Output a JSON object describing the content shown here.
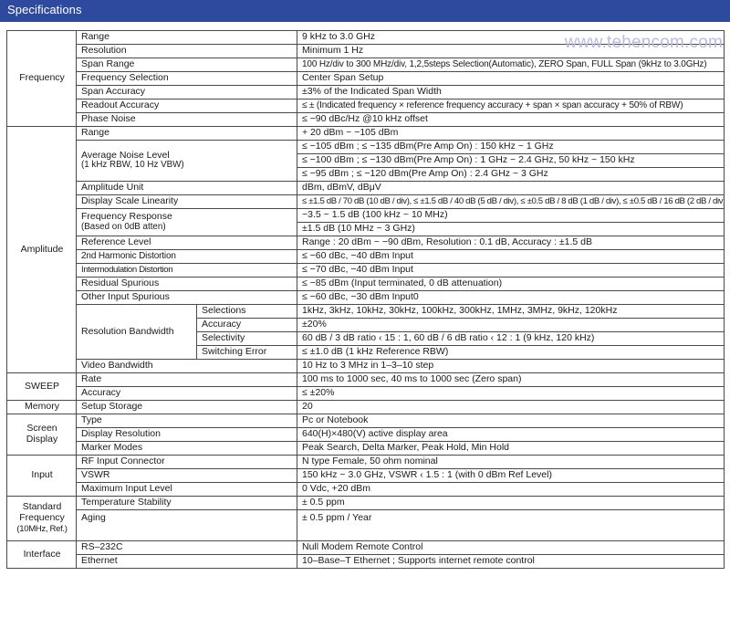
{
  "banner": {
    "title": "Specifications"
  },
  "watermark": {
    "text": "www.tehencom.com",
    "color": "#b9bbe6"
  },
  "colors": {
    "banner_bg": "#2d4a9e",
    "label_bg": "#eaeaea",
    "group_bg": "#e9e9e9",
    "border": "#4a4a4a"
  },
  "rows": {
    "frequency": {
      "group": "Frequency",
      "range_label": "Range",
      "range_value": "9 kHz to 3.0 GHz",
      "resolution_label": "Resolution",
      "resolution_value": "Minimum 1 Hz",
      "span_range_label": "Span Range",
      "span_range_value": "100 Hz/div to 300 MHz/div, 1,2,5steps Selection(Automatic), ZERO Span, FULL Span (9kHz to 3.0GHz)",
      "frequency_selection_label": "Frequency Selection",
      "frequency_selection_value": "Center Span Setup",
      "span_accuracy_label": "Span Accuracy",
      "span_accuracy_value": "±3% of the Indicated Span Width",
      "readout_accuracy_label": "Readout Accuracy",
      "readout_accuracy_value": "≤ ± (Indicated frequency × reference frequency accuracy + span × span accuracy + 50% of RBW)",
      "phase_noise_label": "Phase Noise",
      "phase_noise_value": "≤ −90 dBc/Hz @10 kHz offset"
    },
    "amplitude": {
      "group": "Amplitude",
      "range_label": "Range",
      "range_value": "+ 20 dBm ~ −105 dBm",
      "anl_label_line1": "Average Noise Level",
      "anl_label_line2": "(1 kHz RBW, 10 Hz VBW)",
      "anl_value_1": "≤ −105 dBm ; ≤ −135 dBm(Pre Amp On) : 150 kHz ~ 1 GHz",
      "anl_value_2": "≤ −100 dBm ; ≤ −130 dBm(Pre Amp On) : 1 GHz ~ 2.4 GHz, 50 kHz ~ 150 kHz",
      "anl_value_3": "≤ −95 dBm ; ≤ −120 dBm(Pre Amp On) : 2.4 GHz ~ 3 GHz",
      "amp_unit_label": "Amplitude Unit",
      "amp_unit_value": "dBm, dBmV, dBμV",
      "disp_scale_label": "Display Scale Linearity",
      "disp_scale_value": "≤ ±1.5 dB / 70 dB (10 dB / div), ≤ ±1.5 dB / 40 dB (5 dB / div), ≤ ±0.5 dB / 8 dB (1 dB / div), ≤ ±0.5 dB / 16 dB (2 dB / div)",
      "freq_resp_label_line1": "Frequency Response",
      "freq_resp_label_line2": "(Based on 0dB atten)",
      "freq_resp_value_1": "−3.5 ~ 1.5 dB (100 kHz ~ 10 MHz)",
      "freq_resp_value_2": "±1.5 dB (10 MHz ~ 3 GHz)",
      "ref_level_label": "Reference Level",
      "ref_level_value": "Range : 20 dBm ~ −90 dBm, Resolution : 0.1 dB, Accuracy : ±1.5 dB",
      "harmonic_label": "2nd Harmonic Distortion",
      "harmonic_value": "≤ −60 dBc, −40 dBm Input",
      "intermod_label": "Intermodulation Distortion",
      "intermod_value": "≤ −70 dBc, −40 dBm Input",
      "residual_label": "Residual Spurious",
      "residual_value": "≤ −85 dBm (Input terminated, 0 dB attenuation)",
      "other_spur_label": "Other Input Spurious",
      "other_spur_value": "≤ −60 dBc, −30 dBm Input0",
      "rbw_label": "Resolution Bandwidth",
      "rbw_selections_label": "Selections",
      "rbw_selections_value": "1kHz, 3kHz, 10kHz, 30kHz, 100kHz, 300kHz, 1MHz, 3MHz, 9kHz, 120kHz",
      "rbw_accuracy_label": "Accuracy",
      "rbw_accuracy_value": "±20%",
      "rbw_selectivity_label": "Selectivity",
      "rbw_selectivity_value": "60 dB / 3 dB ratio ‹ 15 : 1, 60 dB / 6 dB ratio ‹ 12 : 1 (9 kHz, 120 kHz)",
      "rbw_switch_label": "Switching Error",
      "rbw_switch_value": "≤ ±1.0 dB (1 kHz Reference RBW)",
      "vbw_label": "Video Bandwidth",
      "vbw_value": "10 Hz to 3 MHz in 1–3–10 step"
    },
    "sweep": {
      "group": "SWEEP",
      "rate_label": "Rate",
      "rate_value": "100 ms to 1000 sec, 40 ms to 1000 sec (Zero span)",
      "accuracy_label": "Accuracy",
      "accuracy_value": "≤ ±20%"
    },
    "memory": {
      "group": "Memory",
      "setup_storage_label": "Setup Storage",
      "setup_storage_value": "20"
    },
    "screen_display": {
      "group_line1": "Screen",
      "group_line2": "Display",
      "type_label": "Type",
      "type_value": "Pc or Notebook",
      "resolution_label": "Display Resolution",
      "resolution_value": "640(H)×480(V) active display area",
      "marker_label": "Marker Modes",
      "marker_value": "Peak Search, Delta Marker, Peak Hold, Min Hold"
    },
    "input": {
      "group": "Input",
      "rf_label": "RF Input Connector",
      "rf_value": "N type Female, 50 ohm nominal",
      "vswr_label": "VSWR",
      "vswr_value": "150 kHz ~ 3.0 GHz, VSWR ‹ 1.5 : 1 (with 0 dBm Ref Level)",
      "max_input_label": "Maximum Input Level",
      "max_input_value": "0 Vdc, +20 dBm"
    },
    "standard_frequency": {
      "group_line1": "Standard",
      "group_line2": "Frequency",
      "group_line3": "(10MHz, Ref.)",
      "temp_label": "Temperature Stability",
      "temp_value": "± 0.5 ppm",
      "aging_label": "Aging",
      "aging_value": "± 0.5 ppm / Year"
    },
    "interface": {
      "group": "Interface",
      "rs232_label": "RS–232C",
      "rs232_value": "Null Modem Remote Control",
      "ethernet_label": "Ethernet",
      "ethernet_value": "10–Base–T Ethernet ; Supports internet remote control"
    }
  }
}
